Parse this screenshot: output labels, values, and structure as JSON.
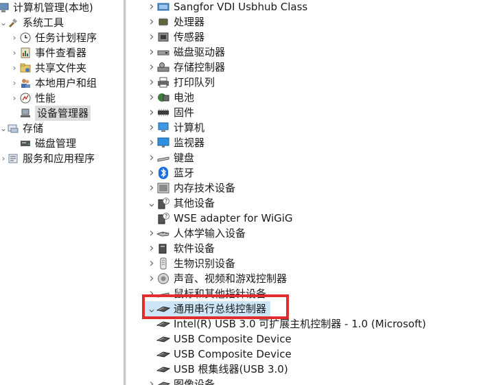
{
  "left_tree": {
    "root": {
      "label": "计算机管理(本地)"
    },
    "system_tools": {
      "label": "系统工具"
    },
    "children": [
      {
        "label": "任务计划程序"
      },
      {
        "label": "事件查看器"
      },
      {
        "label": "共享文件夹"
      },
      {
        "label": "本地用户和组"
      },
      {
        "label": "性能"
      },
      {
        "label": "设备管理器",
        "selected": true
      }
    ],
    "storage": {
      "label": "存储"
    },
    "disk_mgmt": {
      "label": "磁盘管理"
    },
    "services": {
      "label": "服务和应用程序"
    }
  },
  "device_tree": {
    "items": [
      {
        "label": "Sangfor VDI Usbhub Class",
        "icon": "usb-hub-icon"
      },
      {
        "label": "处理器",
        "icon": "processor-icon"
      },
      {
        "label": "传感器",
        "icon": "sensor-icon"
      },
      {
        "label": "磁盘驱动器",
        "icon": "disk-drive-icon"
      },
      {
        "label": "存储控制器",
        "icon": "storage-controller-icon"
      },
      {
        "label": "打印队列",
        "icon": "printer-icon"
      },
      {
        "label": "电池",
        "icon": "battery-icon"
      },
      {
        "label": "固件",
        "icon": "firmware-icon"
      },
      {
        "label": "计算机",
        "icon": "computer-icon"
      },
      {
        "label": "监视器",
        "icon": "monitor-icon"
      },
      {
        "label": "键盘",
        "icon": "keyboard-icon"
      },
      {
        "label": "蓝牙",
        "icon": "bluetooth-icon"
      },
      {
        "label": "内存技术设备",
        "icon": "memory-device-icon"
      },
      {
        "label": "其他设备",
        "icon": "unknown-device-icon",
        "expanded": true
      },
      {
        "label": "WSE adapter for WiGiG",
        "icon": "unknown-device-icon",
        "child": true
      },
      {
        "label": "人体学输入设备",
        "icon": "hid-icon"
      },
      {
        "label": "软件设备",
        "icon": "software-device-icon"
      },
      {
        "label": "生物识别设备",
        "icon": "biometric-icon"
      },
      {
        "label": "声音、视频和游戏控制器",
        "icon": "sound-icon"
      },
      {
        "label": "鼠标和其他指针设备",
        "icon": "mouse-icon"
      },
      {
        "label": "通用串行总线控制器",
        "icon": "usb-controller-icon",
        "expanded": true,
        "highlighted": true
      },
      {
        "label": "Intel(R) USB 3.0 可扩展主机控制器 - 1.0 (Microsoft)",
        "icon": "usb-controller-icon",
        "child": true
      },
      {
        "label": "USB Composite Device",
        "icon": "usb-controller-icon",
        "child": true
      },
      {
        "label": "USB Composite Device",
        "icon": "usb-controller-icon",
        "child": true
      },
      {
        "label": "USB 根集线器(USB 3.0)",
        "icon": "usb-controller-icon",
        "child": true
      },
      {
        "label": "图像设备",
        "icon": "imaging-icon"
      }
    ]
  },
  "colors": {
    "highlight_border": "#e02e2e",
    "selection_bg": "#dcdcdc",
    "row_highlight": "#cde6f7"
  }
}
